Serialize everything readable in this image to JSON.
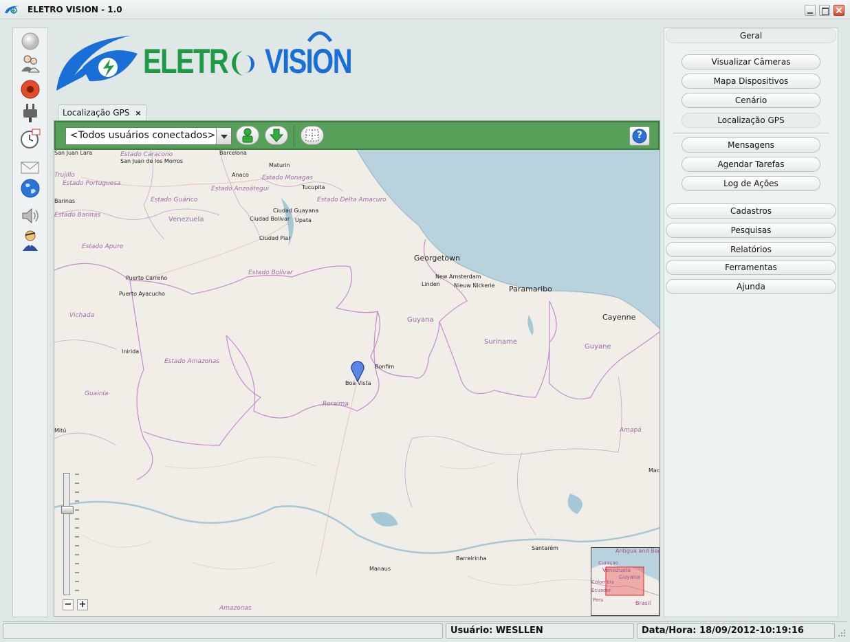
{
  "window": {
    "title": "ELETRO VISION - 1.0"
  },
  "logo": {
    "part1": "ELETR",
    "part2": "VISION"
  },
  "sidebar_icons": [
    "status-icon",
    "users-icon",
    "record-icon",
    "plug-icon",
    "schedule-icon",
    "mail-icon",
    "globe-icon",
    "speaker-icon",
    "operator-icon"
  ],
  "tab": {
    "label": "Localização GPS",
    "close": "×"
  },
  "toolbar": {
    "user_select": "<Todos usuários conectados>",
    "help": "?"
  },
  "map": {
    "marker_label": "Boa Vista",
    "big_cities": [
      "Georgetown",
      "Paramaribo",
      "Cayenne"
    ],
    "cities": [
      "Barcelona",
      "San Juan de los Morros",
      "Anaco",
      "Maturin",
      "Tucupita",
      "Ciudad Guayana",
      "Ciudad Bolivar",
      "Upata",
      "Ciudad Piar",
      "Puerto Carreño",
      "Puerto Ayacucho",
      "New Amsterdam",
      "Linden",
      "Nieuw Nickerie",
      "Bonfim",
      "Inirida",
      "Manaus",
      "Barreirinha",
      "Santarém",
      "San Juan Lara",
      "Mitú",
      "Maca",
      "Trujillo",
      "Barinas",
      "Estado Caracono"
    ],
    "regions": [
      "Estado Portuguesa",
      "Estado Guárico",
      "Estado Anzoátegui",
      "Estado Monagas",
      "Estado Delta Amacuro",
      "Estado Barinas",
      "Estado Apure",
      "Estado Bolívar",
      "Vichada",
      "Estado Amazonas",
      "Guainía",
      "Roraima",
      "Amapá",
      "Amazonas"
    ],
    "countries": [
      "Venezuela",
      "Guyana",
      "Suriname",
      "Guyane"
    ],
    "minimap_labels": [
      "Antigua and Barbuda",
      "Curaçao",
      "Venezuela",
      "Guyana",
      "Colombia",
      "Ecuador",
      "Peru",
      "Brasil"
    ],
    "zoom_minus": "−",
    "zoom_plus": "+"
  },
  "rightnav": {
    "geral": "Geral",
    "items": [
      "Visualizar Câmeras",
      "Mapa Dispositivos",
      "Cenário",
      "Localização GPS",
      "Mensagens",
      "Agendar Tarefas",
      "Log de Ações"
    ],
    "sections": [
      "Cadastros",
      "Pesquisas",
      "Relatórios",
      "Ferramentas",
      "Ajunda"
    ]
  },
  "status": {
    "user": "Usuário: WESLLEN",
    "datetime": "Data/Hora: 18/09/2012-10:19:16"
  },
  "colors": {
    "toolbar": "#57a05a",
    "logo_green": "#1f9a44",
    "logo_blue": "#1a6fd6",
    "sea": "#b8d3de",
    "land": "#f1eee7",
    "border": "#c38ad1"
  }
}
